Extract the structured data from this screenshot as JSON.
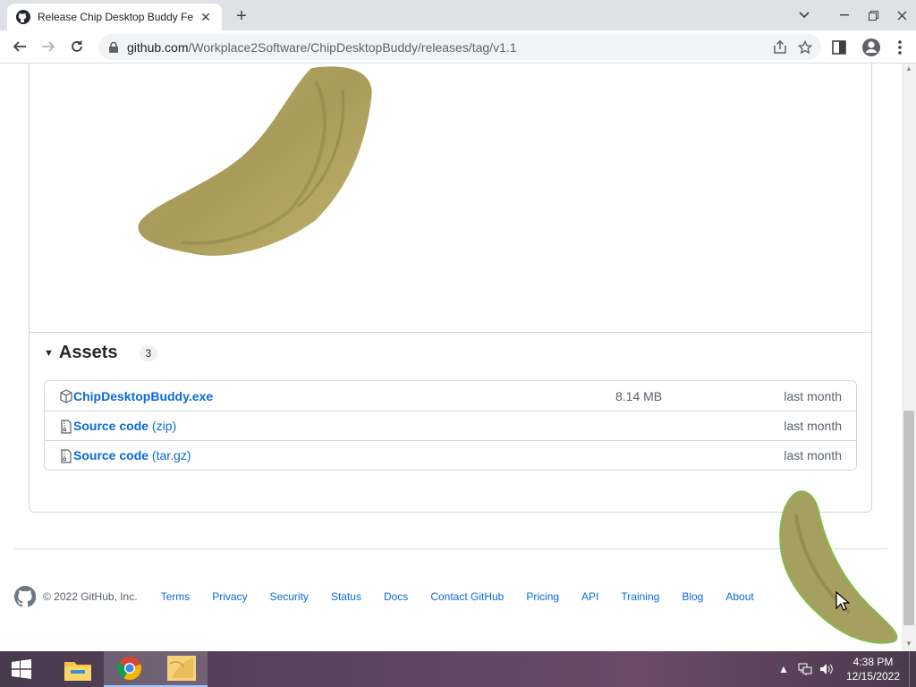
{
  "browser": {
    "tab_title": "Release Chip Desktop Buddy Fea",
    "new_tab_symbol": "+",
    "url_host": "github.com",
    "url_path": "/Workplace2Software/ChipDesktopBuddy/releases/tag/v1.1"
  },
  "assets": {
    "title": "Assets",
    "count": "3",
    "items": [
      {
        "name": "ChipDesktopBuddy.exe",
        "suffix": "",
        "size": "8.14 MB",
        "date": "last month",
        "icon": "package-icon"
      },
      {
        "name": "Source code",
        "suffix": " (zip)",
        "size": "",
        "date": "last month",
        "icon": "file-zip-icon"
      },
      {
        "name": "Source code",
        "suffix": " (tar.gz)",
        "size": "",
        "date": "last month",
        "icon": "file-zip-icon"
      }
    ]
  },
  "footer": {
    "copyright": "© 2022 GitHub, Inc.",
    "links": [
      "Terms",
      "Privacy",
      "Security",
      "Status",
      "Docs",
      "Contact GitHub",
      "Pricing",
      "API",
      "Training",
      "Blog",
      "About"
    ]
  },
  "taskbar": {
    "time": "4:38 PM",
    "date": "12/15/2022"
  },
  "colors": {
    "link": "#0969da",
    "taskbar": "#5a4560"
  }
}
